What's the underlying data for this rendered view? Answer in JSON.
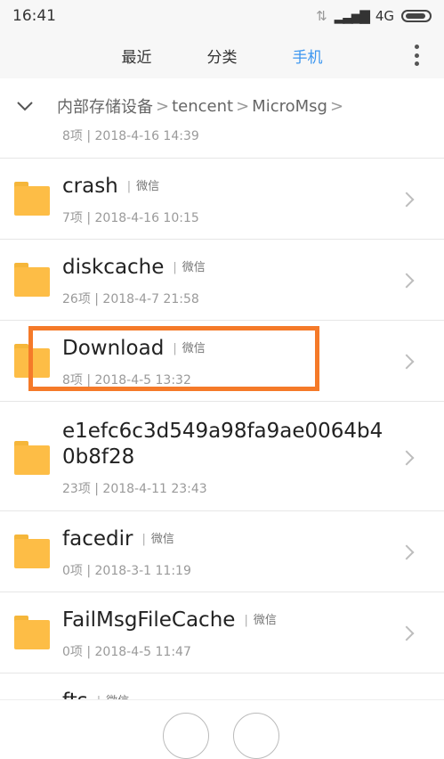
{
  "status": {
    "time": "16:41",
    "network": "4G"
  },
  "tabs": [
    {
      "label": "最近"
    },
    {
      "label": "分类"
    },
    {
      "label": "手机",
      "active": true
    }
  ],
  "breadcrumb": {
    "parts": [
      "内部存储设备",
      "tencent",
      "MicroMsg"
    ],
    "separator": ">"
  },
  "files": [
    {
      "name": "",
      "meta": "8项 | 2018-4-16 14:39"
    },
    {
      "name": "crash",
      "badge": "微信",
      "meta": "7项 | 2018-4-16 10:15"
    },
    {
      "name": "diskcache",
      "badge": "微信",
      "meta": "26项 | 2018-4-7 21:58"
    },
    {
      "name": "Download",
      "badge": "微信",
      "meta": "8项 | 2018-4-5 13:32"
    },
    {
      "name_line1": "e1efc6c3d549a98fa9ae0064b4",
      "name_line2": "0b8f28",
      "meta": "23项 | 2018-4-11 23:43"
    },
    {
      "name": "facedir",
      "badge": "微信",
      "meta": "0项 | 2018-3-1 11:19"
    },
    {
      "name": "FailMsgFileCache",
      "badge": "微信",
      "meta": "0项 | 2018-4-5 11:47"
    },
    {
      "name": "fts",
      "badge": "微信"
    }
  ],
  "colors": {
    "accent": "#3b96f0",
    "folder": "#fdbd46",
    "highlight": "#f57a29"
  }
}
